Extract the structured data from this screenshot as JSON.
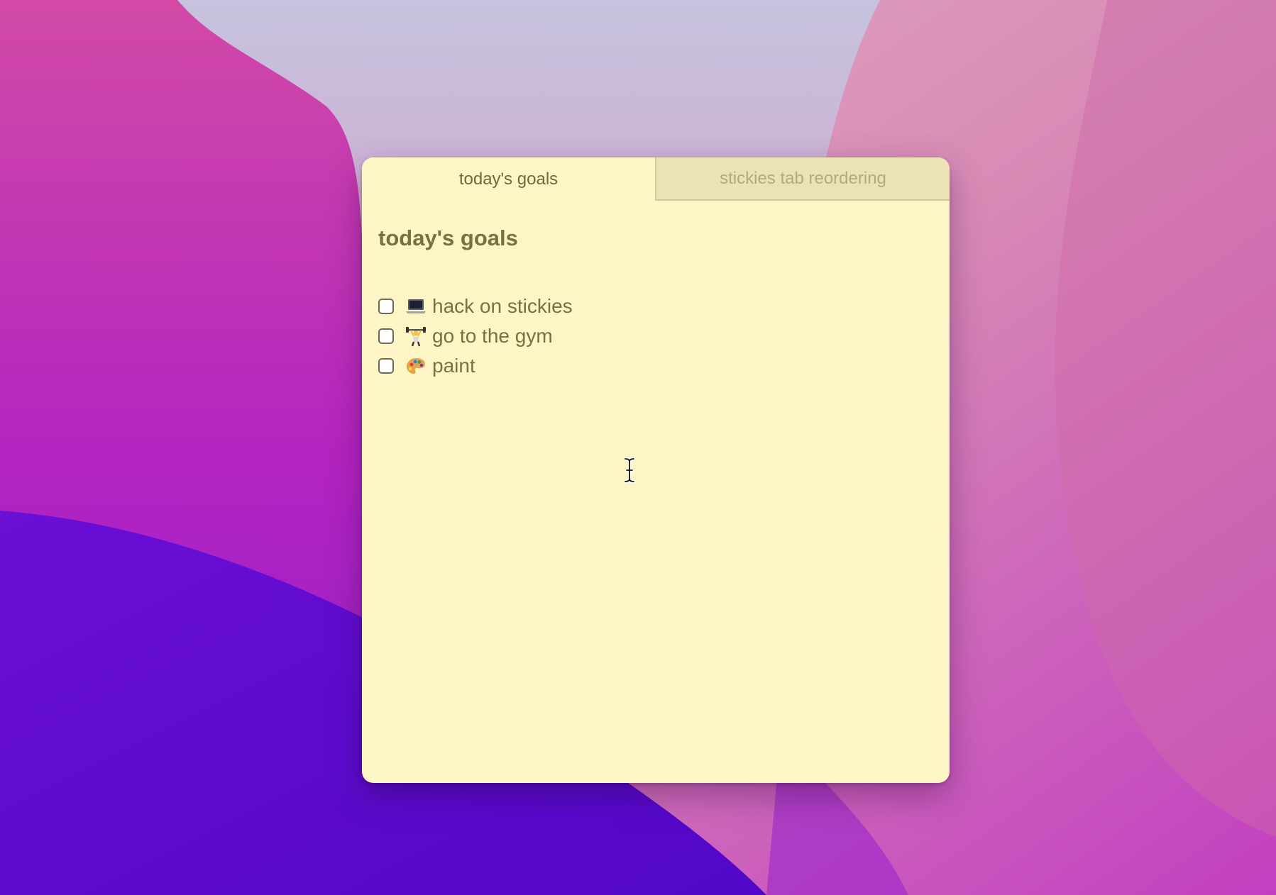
{
  "window": {
    "tabs": [
      {
        "label": "today's goals",
        "active": true
      },
      {
        "label": "stickies tab reordering",
        "active": false
      }
    ]
  },
  "note": {
    "title": "today's goals",
    "checklist": [
      {
        "label": "hack on stickies",
        "icon": "laptop-icon",
        "checked": false
      },
      {
        "label": "go to the gym",
        "icon": "weightlifter-icon",
        "checked": false
      },
      {
        "label": "paint",
        "icon": "artist-palette-icon",
        "checked": false
      }
    ]
  },
  "colors": {
    "note_background": "#fef5c7",
    "inactive_tab": "#ebe2b5",
    "text": "#77723a",
    "inactive_text": "#b3ab7c"
  }
}
